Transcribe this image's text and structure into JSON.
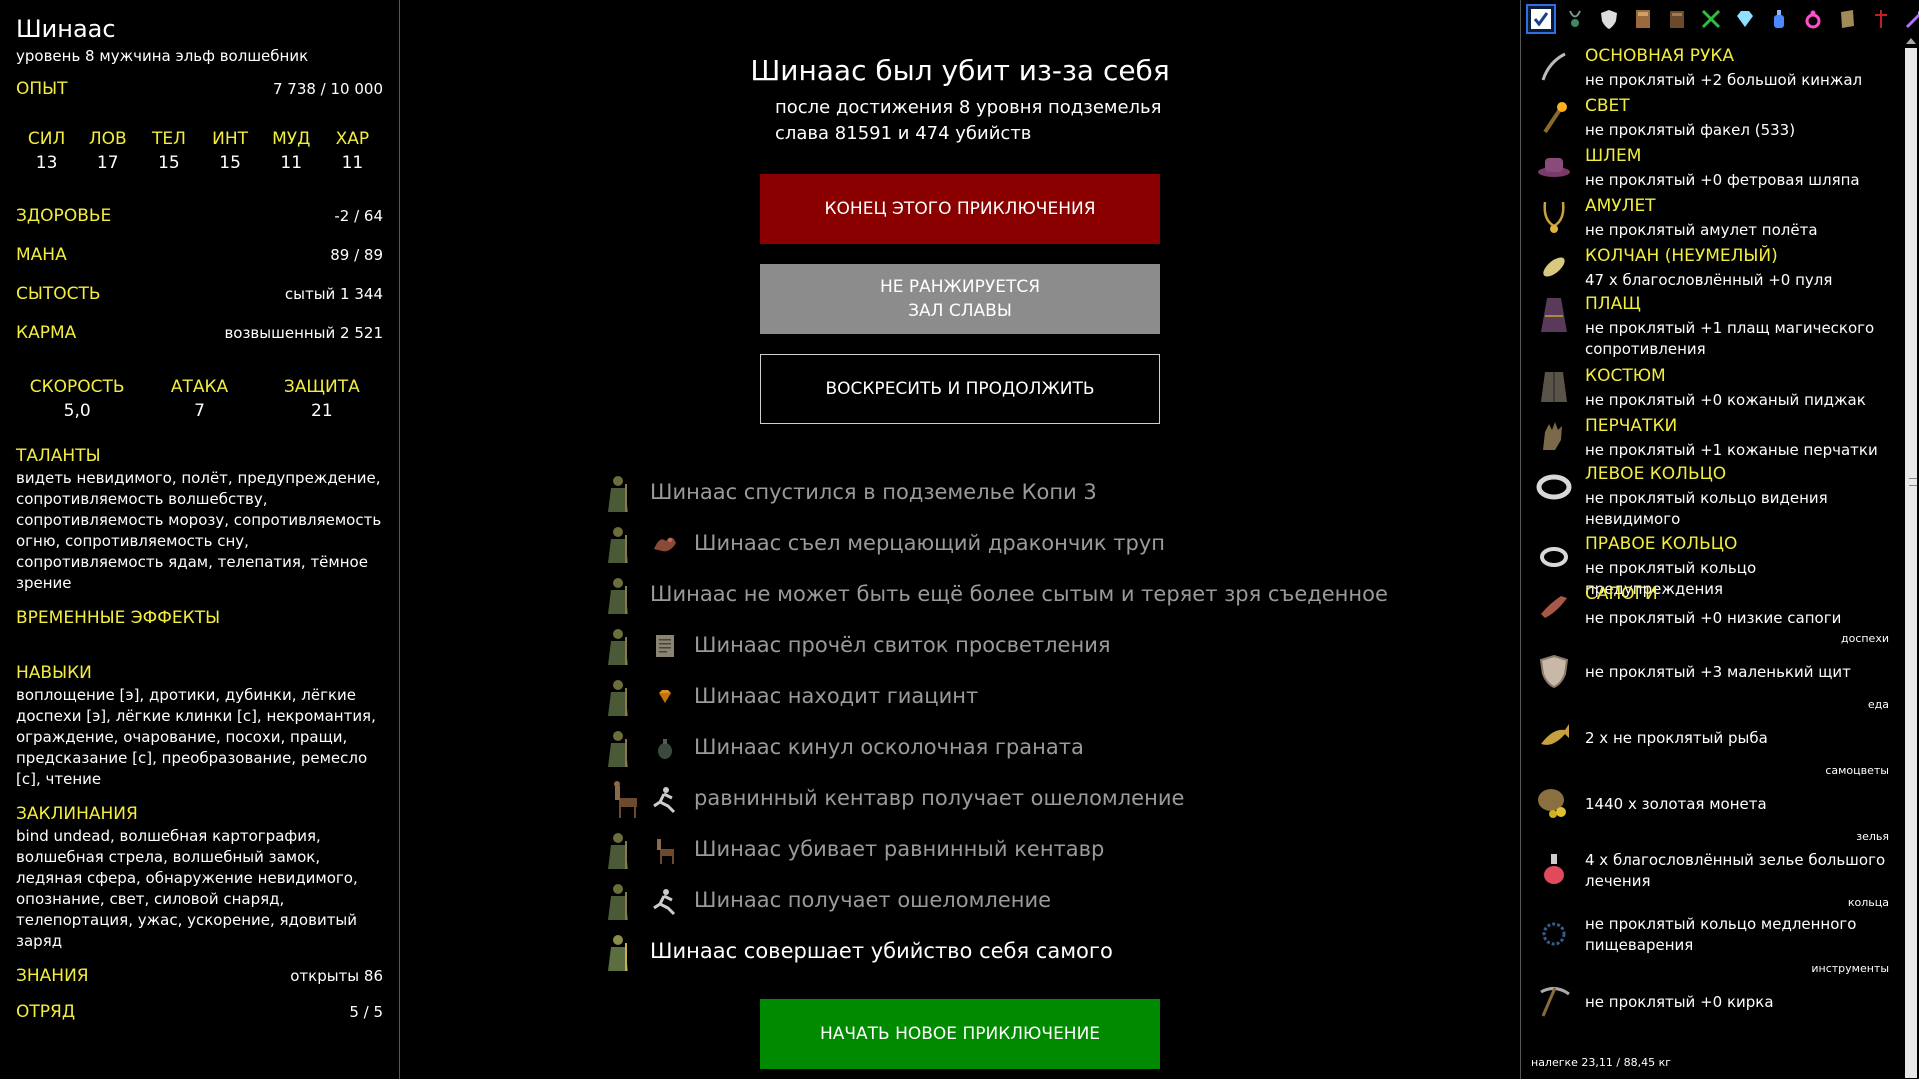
{
  "character": {
    "name": "Шинаас",
    "subtitle": "уровень 8 мужчина эльф волшебник",
    "exp_label": "ОПЫТ",
    "exp_value": "7 738 / 10 000",
    "stats": [
      {
        "name": "СИЛ",
        "value": "13"
      },
      {
        "name": "ЛОВ",
        "value": "17"
      },
      {
        "name": "ТЕЛ",
        "value": "15"
      },
      {
        "name": "ИНТ",
        "value": "15"
      },
      {
        "name": "МУД",
        "value": "11"
      },
      {
        "name": "ХАР",
        "value": "11"
      }
    ],
    "health_label": "ЗДОРОВЬЕ",
    "health_value": "-2 / 64",
    "mana_label": "МАНА",
    "mana_value": "89 / 89",
    "satiety_label": "СЫТОСТЬ",
    "satiety_value": "сытый 1 344",
    "karma_label": "КАРМА",
    "karma_value": "возвышенный 2 521",
    "combat": [
      {
        "name": "СКОРОСТЬ",
        "value": "5,0"
      },
      {
        "name": "АТАКА",
        "value": "7"
      },
      {
        "name": "ЗАЩИТА",
        "value": "21"
      }
    ],
    "talents_label": "ТАЛАНТЫ",
    "talents_text": "видеть невидимого, полёт, предупреждение, сопротивляемость волшебству, сопротивляемость морозу, сопротивляемость огню, сопротивляемость сну, сопротивляемость ядам, телепатия, тёмное зрение",
    "effects_label": "ВРЕМЕННЫЕ ЭФФЕКТЫ",
    "skills_label": "НАВЫКИ",
    "skills_text": "воплощение [э], дротики, дубинки, лёгкие доспехи [э], лёгкие клинки [с], некромантия, ограждение, очарование, посохи, пращи, предсказание [с], преобразование, ремесло [с], чтение",
    "spells_label": "ЗАКЛИНАНИЯ",
    "spells_text": "bind undead, волшебная картография, волшебная стрела, волшебный замок, ледяная сфера, обнаружение невидимого, опознание, свет, силовой снаряд, телепортация, ужас, ускорение, ядовитый заряд",
    "knowledge_label": "ЗНАНИЯ",
    "knowledge_value": "открыты 86",
    "party_label": "ОТРЯД",
    "party_value": "5 / 5"
  },
  "death": {
    "title": "Шинаас был убит из-за себя",
    "line1": "после достижения 8 уровня подземелья",
    "line2": "слава 81591 и 474 убийств",
    "btn_end": "КОНЕЦ ЭТОГО ПРИКЛЮЧЕНИЯ",
    "btn_hof_1": "НЕ РАНЖИРУЕТСЯ",
    "btn_hof_2": "ЗАЛ СЛАВЫ",
    "btn_resurrect": "ВОСКРЕСИТЬ И ПРОДОЛЖИТЬ",
    "btn_new": "НАЧАТЬ НОВОЕ ПРИКЛЮЧЕНИЕ"
  },
  "log": [
    {
      "text": "Шинаас спустился в подземелье Копи 3",
      "icon": "none"
    },
    {
      "text": "Шинаас съел мерцающий дракончик труп",
      "icon": "corpse-icon"
    },
    {
      "text": "Шинаас не может быть ещё более сытым и теряет зря съеденное",
      "icon": "none"
    },
    {
      "text": "Шинаас прочёл свиток просветления",
      "icon": "scroll-icon"
    },
    {
      "text": "Шинаас находит гиацинт",
      "icon": "gem-icon"
    },
    {
      "text": "Шинаас кинул осколочная граната",
      "icon": "grenade-icon"
    },
    {
      "text": "равнинный кентавр получает ошеломление",
      "icon": "stun-icon"
    },
    {
      "text": "Шинаас убивает равнинный кентавр",
      "icon": "centaur-icon"
    },
    {
      "text": "Шинаас получает ошеломление",
      "icon": "stun-icon"
    },
    {
      "text": "Шинаас совершает убийство себя самого",
      "icon": "none"
    }
  ],
  "inventory": {
    "items": [
      {
        "title": "ОСНОВНАЯ РУКА",
        "desc": "не проклятый +2 большой кинжал",
        "icon": "dagger-icon"
      },
      {
        "title": "СВЕТ",
        "desc": "не проклятый факел (533)",
        "icon": "torch-icon"
      },
      {
        "title": "ШЛЕМ",
        "desc": "не проклятый +0 фетровая шляпа",
        "icon": "hat-icon"
      },
      {
        "title": "АМУЛЕТ",
        "desc": "не проклятый амулет полёта",
        "icon": "amulet-icon"
      },
      {
        "title": "КОЛЧАН (НЕУМЕЛЫЙ)",
        "desc": "47 х благословлённый +0 пуля",
        "icon": "bullet-icon"
      },
      {
        "title": "ПЛАЩ",
        "desc": "не проклятый +1 плащ магического сопротивления",
        "icon": "cloak-icon"
      },
      {
        "title": "КОСТЮМ",
        "desc": "не проклятый +0 кожаный пиджак",
        "icon": "jacket-icon"
      },
      {
        "title": "ПЕРЧАТКИ",
        "desc": "не проклятый +1 кожаные перчатки",
        "icon": "gloves-icon"
      },
      {
        "title": "ЛЕВОЕ КОЛЬЦО",
        "desc": "не проклятый кольцо видения невидимого",
        "icon": "ring-icon"
      },
      {
        "title": "ПРАВОЕ КОЛЬЦО",
        "desc": "не проклятый кольцо предупреждения",
        "icon": "ring-icon"
      },
      {
        "title": "САПОГИ",
        "desc": "не проклятый +0 низкие сапоги",
        "icon": "boots-icon"
      }
    ],
    "categories": {
      "armor": "доспехи",
      "food": "еда",
      "gems": "самоцветы",
      "potions": "зелья",
      "rings": "кольца",
      "tools": "инструменты"
    },
    "pack": [
      {
        "desc": "не проклятый +3 маленький щит",
        "icon": "shield-icon"
      },
      {
        "desc": "2 х не проклятый рыба",
        "icon": "fish-icon"
      },
      {
        "desc": "1440 х золотая монета",
        "icon": "coins-icon"
      },
      {
        "desc": "4 х благословлённый зелье большого лечения",
        "icon": "potion-icon"
      },
      {
        "desc": "не проклятый кольцо медленного пищеварения",
        "icon": "ring-icon"
      },
      {
        "desc": "не проклятый +0 кирка",
        "icon": "pickaxe-icon"
      }
    ],
    "weight": "налегке 23,11 / 88,45 кг"
  },
  "colors": {
    "accent": "#f3ed3f",
    "end_button": "#8a0000",
    "hof_button": "#8c8c8c",
    "new_button": "#008a00"
  }
}
